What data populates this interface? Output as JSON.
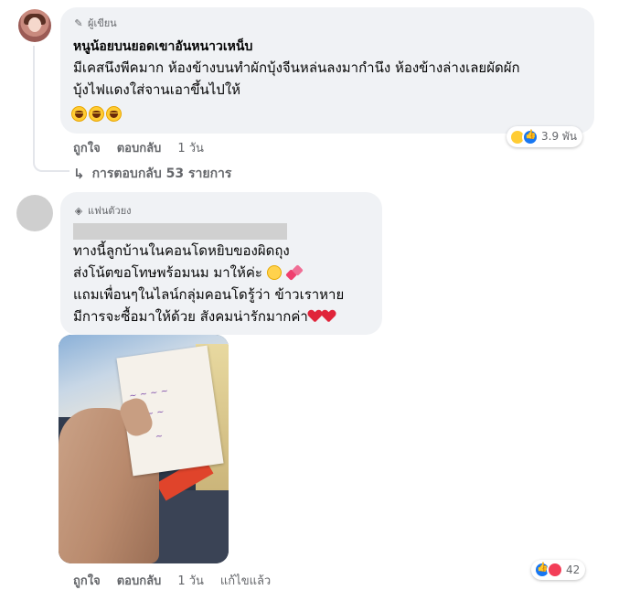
{
  "comment1": {
    "badge": "ผู้เขียน",
    "author": "หนูน้อยบนยอดเขาอันหนาวเหน็บ",
    "lines": [
      "มีเคสนึงพีคมาก ห้องข้างบนทำผักบุ้งจีนหล่นลงมากำนึง ห้องข้างล่างเลยผัดผัก",
      "บุ้งไฟแดงใส่จานเอาขึ้นไปให้"
    ],
    "like_label": "ถูกใจ",
    "reply_label": "ตอบกลับ",
    "time": "1 วัน",
    "reaction_count": "3.9 พัน",
    "replies_label": "การตอบกลับ 53 รายการ"
  },
  "comment2": {
    "badge": "แฟนตัวยง",
    "lines": [
      "ทางนี้ลูกบ้านในคอนโดหยิบของผิดถุง",
      "ส่งโน้ตขอโทษพร้อมนม มาให้ค่ะ",
      "แถมเพื่อนๆในไลน์กลุ่มคอนโดรู้ว่า ข้าวเราหาย",
      "มีการจะซื้อมาให้ด้วย สังคมน่ารักมากค่า"
    ],
    "photo_alt": "ลูกบ้านถือโน้ตขอโทษ",
    "like_label": "ถูกใจ",
    "reply_label": "ตอบกลับ",
    "time": "1 วัน",
    "edited_label": "แก้ไขแล้ว",
    "reaction_count": "42"
  },
  "icons": {
    "badge1": "pen-icon",
    "badge2": "diamond-icon",
    "reply_arrow": "reply-arrow-icon"
  },
  "colors": {
    "bubble": "#f0f2f5",
    "muted_text": "#65676b",
    "like_blue": "#1877f2",
    "love_red": "#f33e58",
    "haha_yellow": "#ffcc33"
  }
}
